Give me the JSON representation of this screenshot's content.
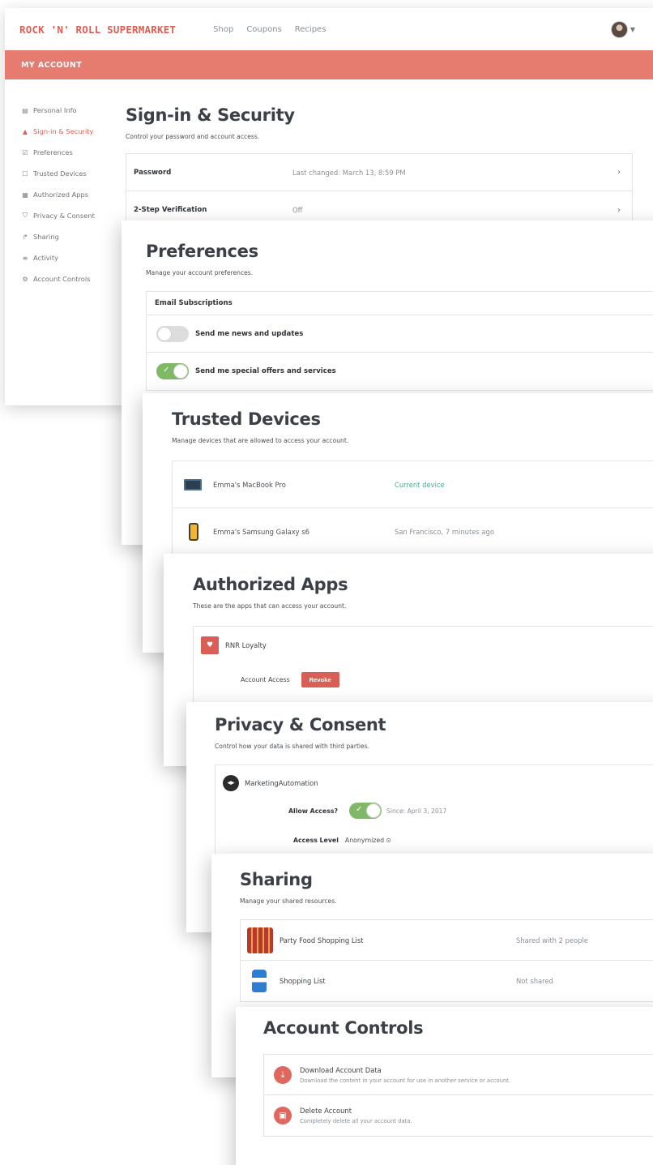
{
  "header": {
    "brand": "ROCK 'N' ROLL SUPERMARKET",
    "nav": [
      "Shop",
      "Coupons",
      "Recipes"
    ],
    "account_bar": "MY ACCOUNT"
  },
  "sidebar": {
    "items": [
      {
        "icon": "id-card-icon",
        "glyph": "▤",
        "label": "Personal Info"
      },
      {
        "icon": "lock-icon",
        "glyph": "▲",
        "label": "Sign-in & Security",
        "active": true
      },
      {
        "icon": "checklist-icon",
        "glyph": "☑",
        "label": "Preferences"
      },
      {
        "icon": "device-icon",
        "glyph": "☐",
        "label": "Trusted Devices"
      },
      {
        "icon": "apps-icon",
        "glyph": "▦",
        "label": "Authorized Apps"
      },
      {
        "icon": "shield-icon",
        "glyph": "⛉",
        "label": "Privacy & Consent"
      },
      {
        "icon": "share-icon",
        "glyph": "↱",
        "label": "Sharing"
      },
      {
        "icon": "list-icon",
        "glyph": "≡",
        "label": "Activity"
      },
      {
        "icon": "gear-icon",
        "glyph": "⚙",
        "label": "Account Controls"
      }
    ]
  },
  "security": {
    "title": "Sign-in & Security",
    "desc": "Control your password and account access.",
    "rows": [
      {
        "label": "Password",
        "value": "Last changed: March 13, 8:59 PM"
      },
      {
        "label": "2-Step Verification",
        "value": "Off"
      }
    ]
  },
  "preferences": {
    "title": "Preferences",
    "desc": "Manage your account preferences.",
    "group": "Email Subscriptions",
    "options": [
      {
        "label": "Send me news and updates",
        "on": false
      },
      {
        "label": "Send me special offers and services",
        "on": true
      }
    ]
  },
  "devices": {
    "title": "Trusted Devices",
    "desc": "Manage devices that are allowed to access your account.",
    "items": [
      {
        "name": "Emma's MacBook Pro",
        "status": "Current device",
        "icon": "laptop-icon"
      },
      {
        "name": "Emma's Samsung Galaxy s6",
        "status": "San Francisco, 7 minutes ago",
        "icon": "phone-icon"
      }
    ]
  },
  "apps": {
    "title": "Authorized Apps",
    "desc": "These are the apps that can access your account.",
    "app_name": "RNR Loyalty",
    "access_label": "Account Access",
    "revoke_label": "Revoke"
  },
  "privacy": {
    "title": "Privacy & Consent",
    "desc": "Control how your data is shared with third parties.",
    "partner": "MarketingAutomation",
    "allow_label": "Allow Access?",
    "allow_since": "Since: April 3, 2017",
    "level_label": "Access Level",
    "level_value": "Anonymized ⊙"
  },
  "sharing": {
    "title": "Sharing",
    "desc": "Manage your shared resources.",
    "items": [
      {
        "name": "Party Food Shopping List",
        "status": "Shared with 2 people"
      },
      {
        "name": "Shopping List",
        "status": "Not shared"
      }
    ]
  },
  "controls": {
    "title": "Account Controls",
    "items": [
      {
        "name": "Download Account Data",
        "desc": "Download the content in your account for use in another service or account."
      },
      {
        "name": "Delete Account",
        "desc": "Completely delete all your account data."
      }
    ]
  },
  "colors": {
    "brand": "#e25c52",
    "account_bar": "#e67b70",
    "toggle_on": "#7fb867",
    "current_device": "#4fa88c"
  }
}
